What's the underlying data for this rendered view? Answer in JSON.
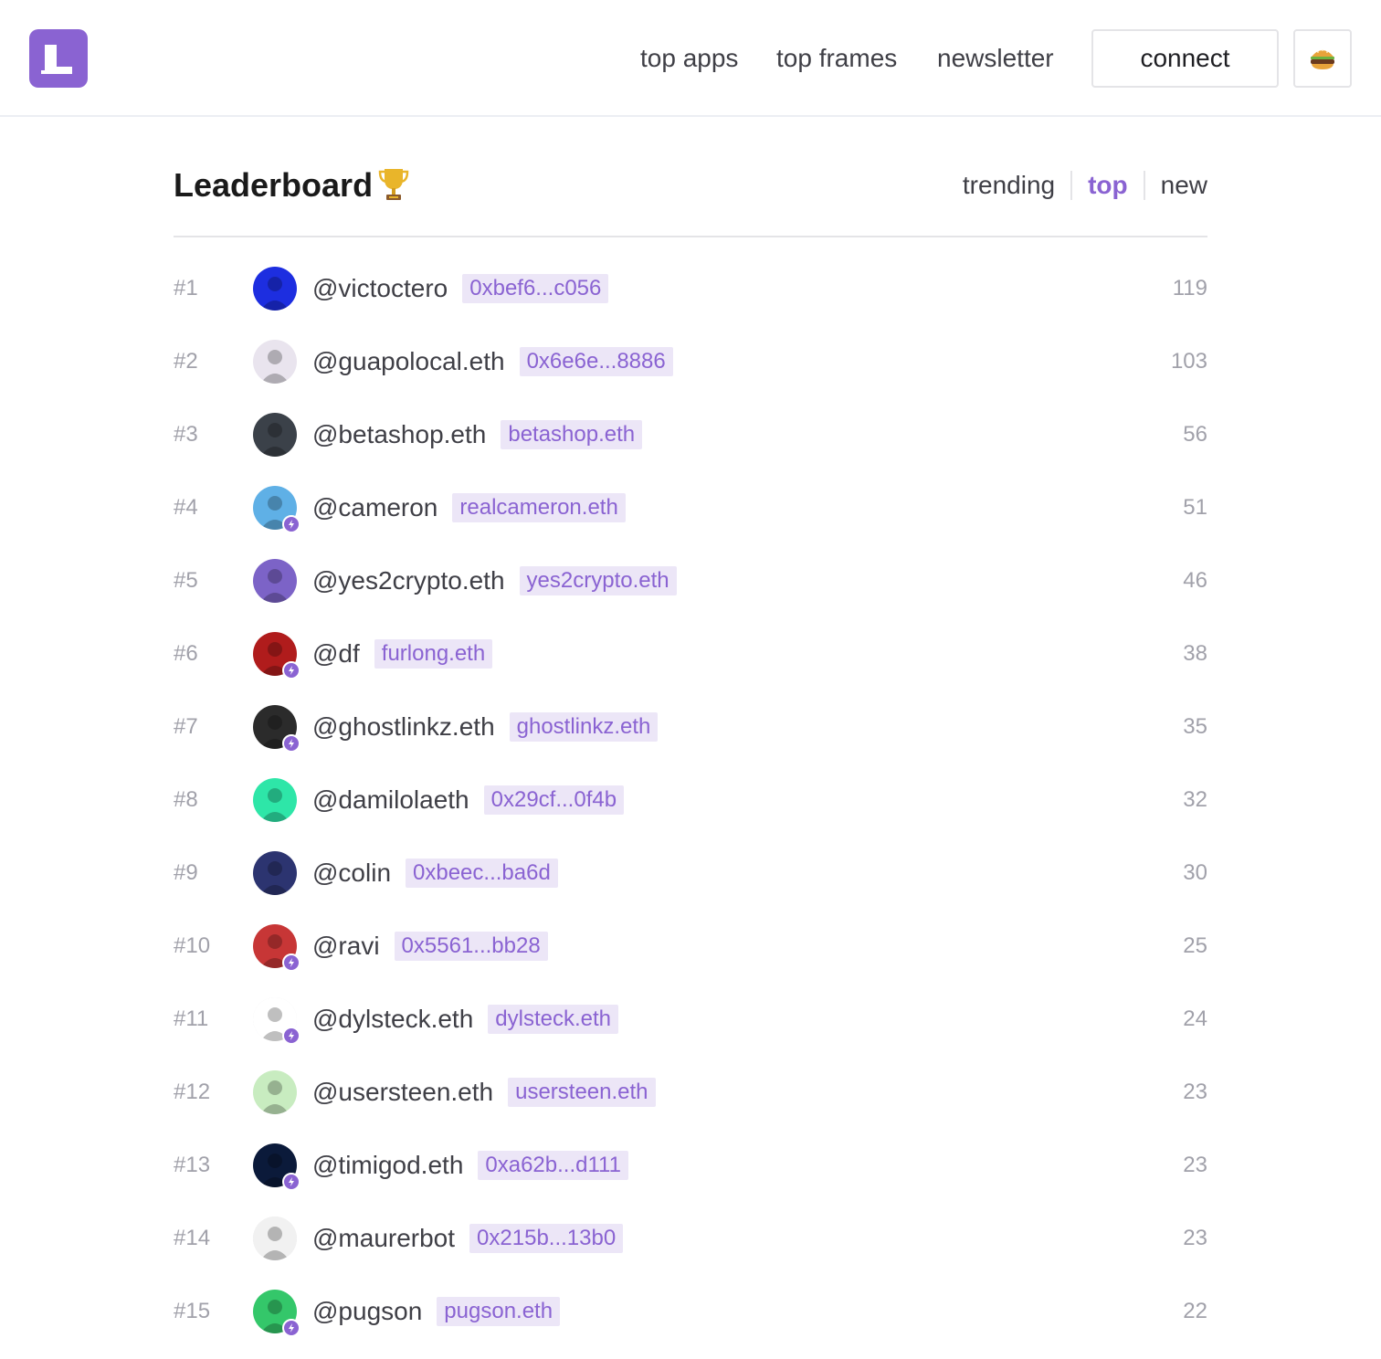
{
  "header": {
    "nav": {
      "top_apps": "top apps",
      "top_frames": "top frames",
      "newsletter": "newsletter"
    },
    "connect_label": "connect",
    "menu_icon": "burger-icon",
    "logo_icon": "logo-l-icon"
  },
  "page": {
    "title": "Leaderboard",
    "title_icon": "trophy-icon",
    "filters": {
      "trending": "trending",
      "top": "top",
      "new": "new"
    },
    "active_filter": "top"
  },
  "colors": {
    "accent": "#8a63d2",
    "tag_bg": "#ece6f7",
    "muted": "#a1a1aa"
  },
  "leaderboard": [
    {
      "rank": "#1",
      "handle": "@victoctero",
      "tag": "0xbef6...c056",
      "count": "119",
      "power_badge": false,
      "avatar_color": "#1d2ee0"
    },
    {
      "rank": "#2",
      "handle": "@guapolocal.eth",
      "tag": "0x6e6e...8886",
      "count": "103",
      "power_badge": false,
      "avatar_color": "#e9e4ee"
    },
    {
      "rank": "#3",
      "handle": "@betashop.eth",
      "tag": "betashop.eth",
      "count": "56",
      "power_badge": false,
      "avatar_color": "#3b4149"
    },
    {
      "rank": "#4",
      "handle": "@cameron",
      "tag": "realcameron.eth",
      "count": "51",
      "power_badge": true,
      "avatar_color": "#5fb0e6"
    },
    {
      "rank": "#5",
      "handle": "@yes2crypto.eth",
      "tag": "yes2crypto.eth",
      "count": "46",
      "power_badge": false,
      "avatar_color": "#7c63c7"
    },
    {
      "rank": "#6",
      "handle": "@df",
      "tag": "furlong.eth",
      "count": "38",
      "power_badge": true,
      "avatar_color": "#b01c1c"
    },
    {
      "rank": "#7",
      "handle": "@ghostlinkz.eth",
      "tag": "ghostlinkz.eth",
      "count": "35",
      "power_badge": true,
      "avatar_color": "#2b2b2b"
    },
    {
      "rank": "#8",
      "handle": "@damilolaeth",
      "tag": "0x29cf...0f4b",
      "count": "32",
      "power_badge": false,
      "avatar_color": "#2ee6a8"
    },
    {
      "rank": "#9",
      "handle": "@colin",
      "tag": "0xbeec...ba6d",
      "count": "30",
      "power_badge": false,
      "avatar_color": "#2c3470"
    },
    {
      "rank": "#10",
      "handle": "@ravi",
      "tag": "0x5561...bb28",
      "count": "25",
      "power_badge": true,
      "avatar_color": "#c73636"
    },
    {
      "rank": "#11",
      "handle": "@dylsteck.eth",
      "tag": "dylsteck.eth",
      "count": "24",
      "power_badge": true,
      "avatar_color": "#ffffff"
    },
    {
      "rank": "#12",
      "handle": "@usersteen.eth",
      "tag": "usersteen.eth",
      "count": "23",
      "power_badge": false,
      "avatar_color": "#c8ecc0"
    },
    {
      "rank": "#13",
      "handle": "@timigod.eth",
      "tag": "0xa62b...d111",
      "count": "23",
      "power_badge": true,
      "avatar_color": "#0b1a3a"
    },
    {
      "rank": "#14",
      "handle": "@maurerbot",
      "tag": "0x215b...13b0",
      "count": "23",
      "power_badge": false,
      "avatar_color": "#f1f1f1"
    },
    {
      "rank": "#15",
      "handle": "@pugson",
      "tag": "pugson.eth",
      "count": "22",
      "power_badge": true,
      "avatar_color": "#34c76a"
    }
  ]
}
